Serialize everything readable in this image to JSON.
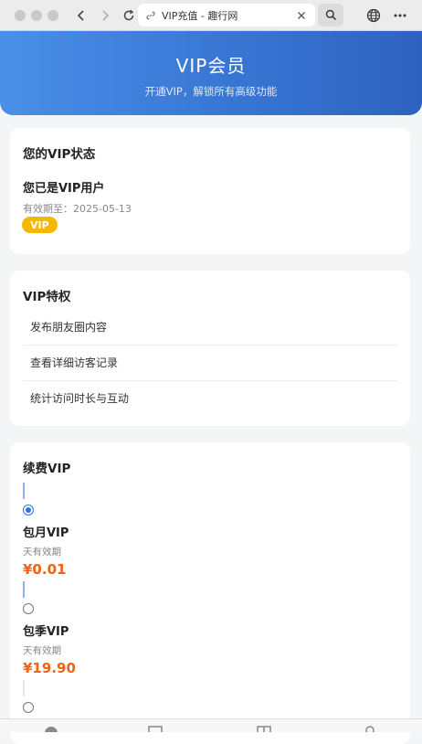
{
  "browser": {
    "tab_title": "VIP充值 - 趣行网",
    "icons": {
      "back": "back-icon",
      "forward": "forward-icon",
      "reload": "reload-icon",
      "link": "link-icon",
      "close": "close-icon",
      "search": "search-icon",
      "globe": "globe-icon",
      "more": "more-icon"
    }
  },
  "header": {
    "title": "VIP会员",
    "subtitle": "开通VIP，解锁所有高级功能"
  },
  "status_card": {
    "title": "您的VIP状态",
    "user_status": "您已是VIP用户",
    "expiry": "有效期至：2025-05-13",
    "badge": "VIP"
  },
  "privileges_card": {
    "title": "VIP特权",
    "items": [
      "发布朋友圈内容",
      "查看详细访客记录",
      "统计访问时长与互动"
    ]
  },
  "renew_card": {
    "title": "续费VIP",
    "plans": [
      {
        "name": "包月VIP",
        "desc": "天有效期",
        "price": "¥0.01",
        "selected": true
      },
      {
        "name": "包季VIP",
        "desc": "天有效期",
        "price": "¥19.90",
        "selected": false
      },
      {
        "name": "",
        "desc": "",
        "price": "",
        "selected": false
      }
    ]
  },
  "colors": {
    "header_start": "#4a8fe8",
    "header_end": "#2e62c0",
    "badge": "#f5b800",
    "price": "#f2620f",
    "radio_selected": "#2f6fe0"
  }
}
